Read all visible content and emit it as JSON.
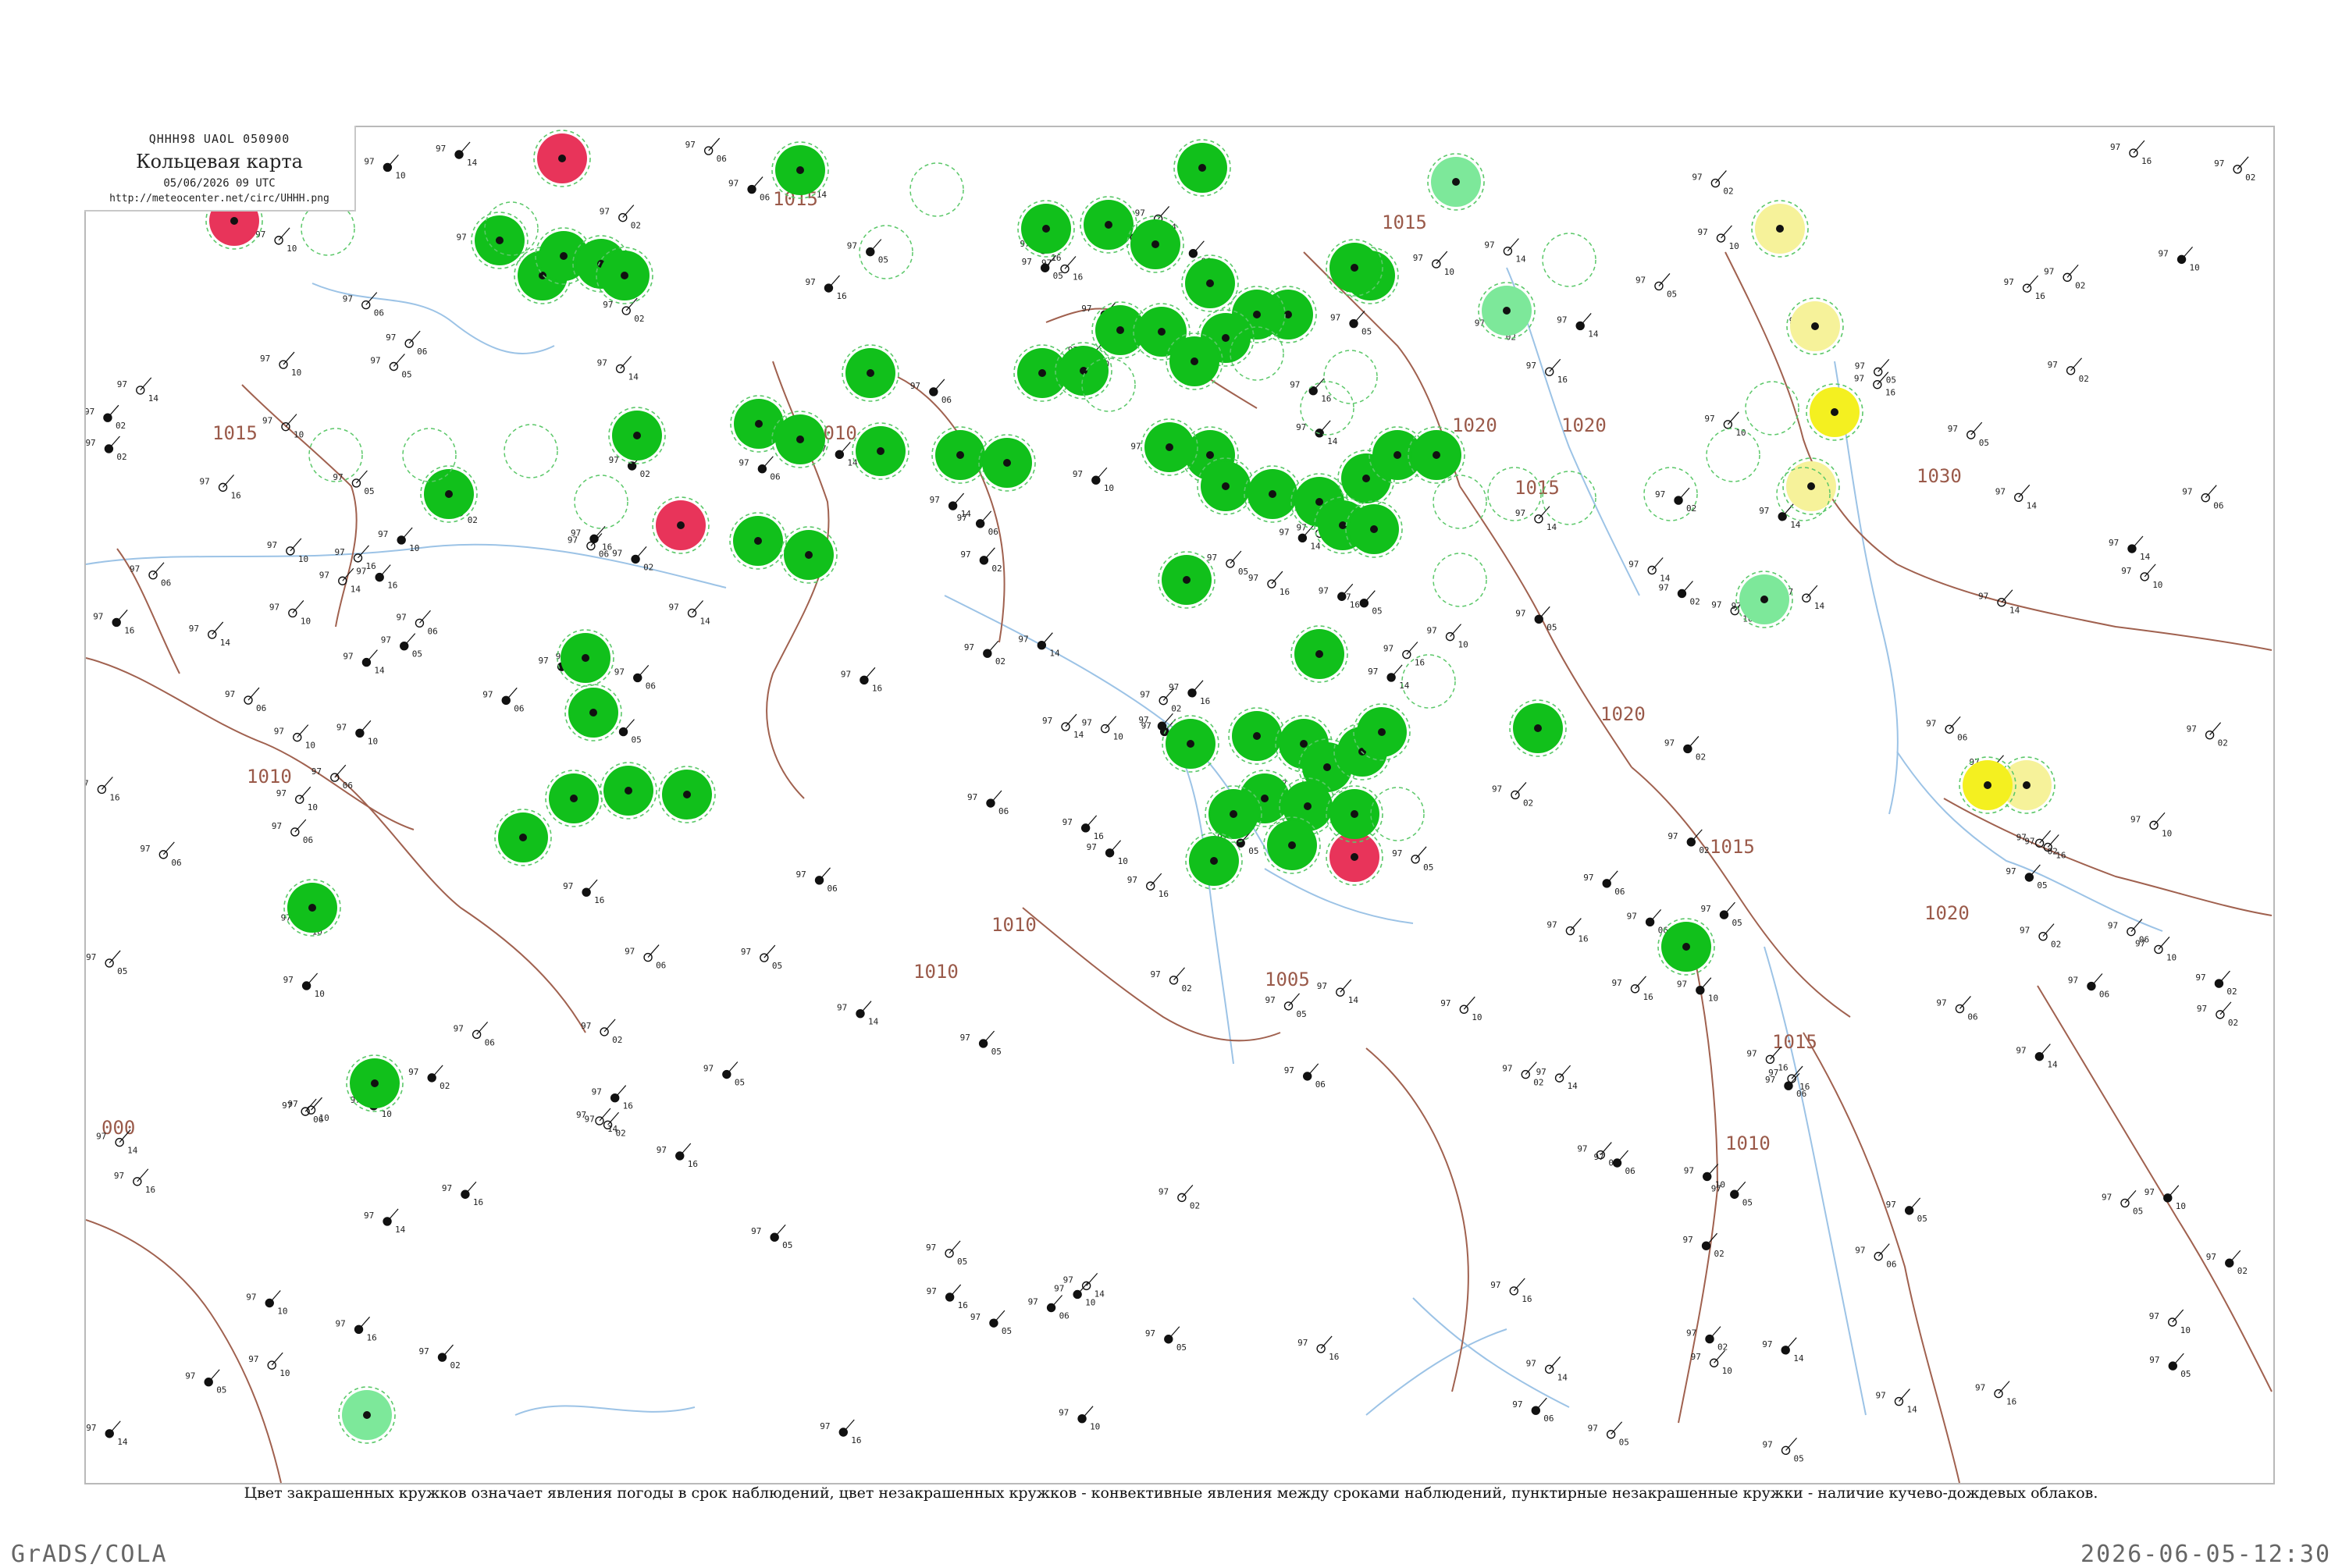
{
  "title": {
    "code": "QHHH98  UAOL  050900",
    "name": "Кольцевая карта",
    "time": "05/06/2026 09 UTC",
    "url": "http://meteocenter.net/circ/UHHH.png"
  },
  "legend_note": "Цвет закрашенных кружков означает явления погоды в срок наблюдений, цвет незакрашенных кружков - конвективные явления между сроками наблюдений, пунктирные незакрашенные кружки - наличие кучево-дождевых облаков.",
  "footer": {
    "left": "GrADS/COLA",
    "right": "2026-06-05-12:30"
  },
  "colors": {
    "rain": "#11c01b",
    "thunder": "#e8345a",
    "shower_light": "#7de89a",
    "fog_yellow": "#f4f020",
    "haze_pale": "#f6f29a",
    "isobar": "#a0614f",
    "river": "#9cc3e6"
  },
  "isobars": [
    "1015",
    "1015",
    "1010",
    "1010",
    "1010",
    "1010",
    "1005",
    "1015",
    "1020",
    "1020",
    "1015",
    "1020",
    "1030",
    "1020",
    "1015",
    "1010",
    "1015",
    "000"
  ],
  "stations": [
    {
      "id": "stn-a",
      "t": "97",
      "p": "16"
    },
    {
      "id": "stn-b",
      "t": "97",
      "p": "05"
    },
    {
      "id": "stn-c",
      "t": "97",
      "p": "10"
    },
    {
      "id": "stn-d",
      "t": "97",
      "p": "06"
    },
    {
      "id": "stn-e",
      "t": "97",
      "p": "14"
    },
    {
      "id": "stn-f",
      "t": "97",
      "p": "02"
    }
  ]
}
